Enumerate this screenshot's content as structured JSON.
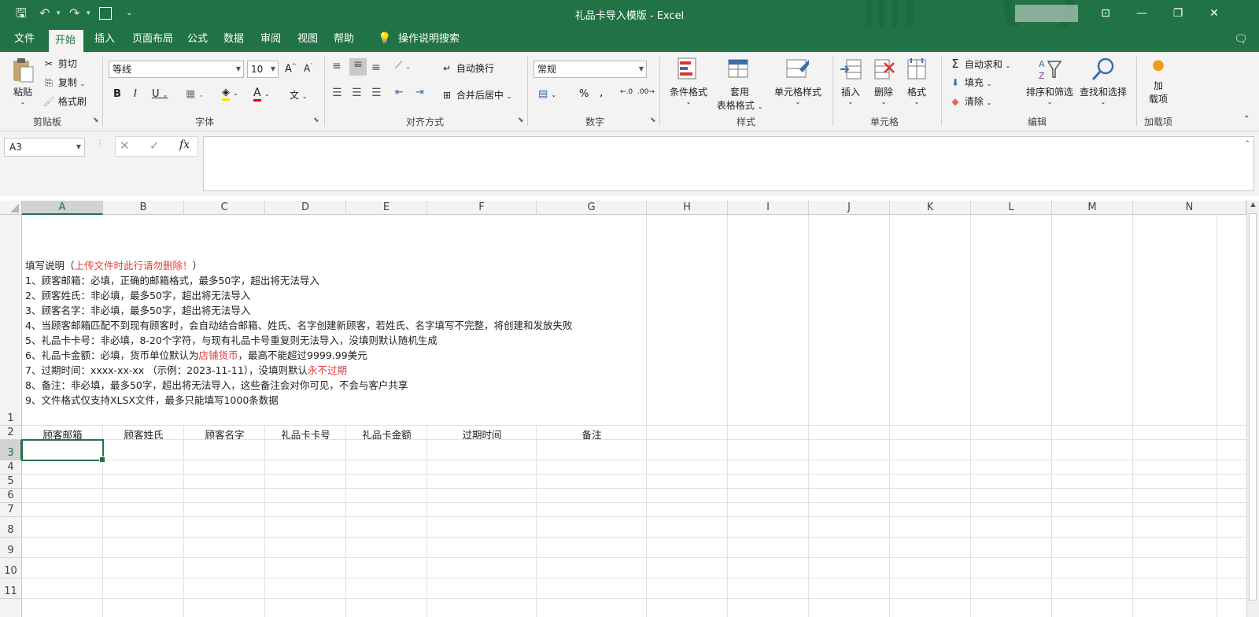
{
  "window": {
    "title": "礼品卡导入模版  -  Excel"
  },
  "tabs": [
    {
      "label": "文件"
    },
    {
      "label": "开始"
    },
    {
      "label": "插入"
    },
    {
      "label": "页面布局"
    },
    {
      "label": "公式"
    },
    {
      "label": "数据"
    },
    {
      "label": "审阅"
    },
    {
      "label": "视图"
    },
    {
      "label": "帮助"
    },
    {
      "label": "操作说明搜索"
    }
  ],
  "ribbon": {
    "clipboard": {
      "paste": "粘贴",
      "cut": "剪切",
      "copy": "复制",
      "format_painter": "格式刷",
      "group": "剪贴板"
    },
    "font": {
      "name": "等线",
      "size": "10",
      "group": "字体"
    },
    "alignment": {
      "wrap": "自动换行",
      "merge": "合并后居中",
      "group": "对齐方式"
    },
    "number": {
      "format": "常规",
      "group": "数字"
    },
    "styles": {
      "conditional": "条件格式",
      "table_line1": "套用",
      "table_line2": "表格格式",
      "cell_styles": "单元格样式",
      "group": "样式"
    },
    "cells": {
      "insert": "插入",
      "delete": "删除",
      "format": "格式",
      "group": "单元格"
    },
    "editing": {
      "autosum": "自动求和",
      "fill": "填充",
      "clear": "清除",
      "sort": "排序和筛选",
      "find": "查找和选择",
      "group": "编辑"
    },
    "addins": {
      "line1": "加",
      "line2": "载项",
      "group": "加载项"
    }
  },
  "formula_bar": {
    "name_box": "A3",
    "fx": "fx",
    "formula": ""
  },
  "columns": [
    "A",
    "B",
    "C",
    "D",
    "E",
    "F",
    "G",
    "H",
    "I",
    "J",
    "K",
    "L",
    "M",
    "N"
  ],
  "rows": [
    "1",
    "2",
    "3",
    "4",
    "5",
    "6",
    "7",
    "8",
    "9",
    "10",
    "11"
  ],
  "instructions": {
    "title_pre": "填写说明（",
    "title_red": "上传文件时此行请勿删除！",
    "title_post": "）",
    "line1": "1、顾客邮箱：必填，正确的邮箱格式，最多50字，超出将无法导入",
    "line2": "2、顾客姓氏：非必填，最多50字，超出将无法导入",
    "line3": "3、顾客名字：非必填，最多50字，超出将无法导入",
    "line4": "4、当顾客邮箱匹配不到现有顾客时，会自动结合邮箱、姓氏、名字创建新顾客，若姓氏、名字填写不完整，将创建和发放失败",
    "line5": "5、礼品卡卡号：非必填，8-20个字符，与现有礼品卡号重复则无法导入，没填则默认随机生成",
    "line6_pre": "6、礼品卡金额：必填，货币单位默认为",
    "line6_red": "店铺货币",
    "line6_post": "，最高不能超过9999.99美元",
    "line7_pre": "7、过期时间：xxxx-xx-xx （示例：2023-11-11），没填则默认",
    "line7_red": "永不过期",
    "line8": "8、备注：非必填，最多50字，超出将无法导入，这些备注会对你可见，不会与客户共享",
    "line9": "9、文件格式仅支持XLSX文件，最多只能填写1000条数据"
  },
  "headers": [
    "顾客邮箱",
    "顾客姓氏",
    "顾客名字",
    "礼品卡卡号",
    "礼品卡金额",
    "过期时间",
    "备注"
  ],
  "colors": {
    "excel_green": "#217346",
    "red_text": "#e23b3b"
  }
}
